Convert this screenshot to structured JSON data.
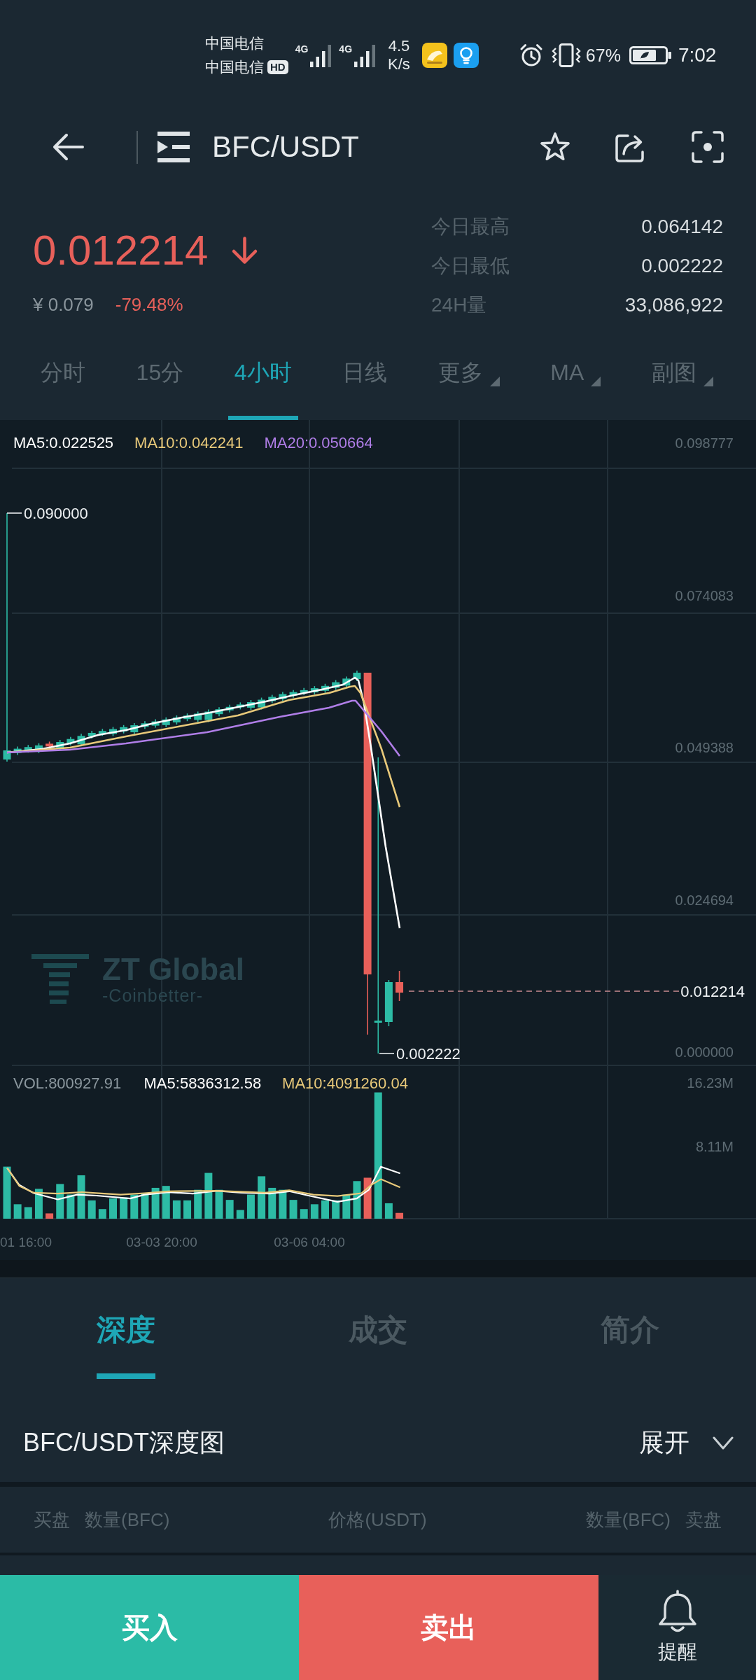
{
  "status_bar": {
    "carriers": [
      "中国电信",
      "中国电信"
    ],
    "hd_badge": "HD",
    "networks": [
      "4G",
      "4G"
    ],
    "speed": "4.5",
    "speed_unit": "K/s",
    "battery": "67%",
    "time": "7:02"
  },
  "header": {
    "title": "BFC/USDT"
  },
  "ticker": {
    "price": "0.012214",
    "falling": true,
    "cny_price": "¥ 0.079",
    "change": "-79.48%",
    "stats": [
      {
        "label": "今日最高",
        "value": "0.064142"
      },
      {
        "label": "今日最低",
        "value": "0.002222"
      },
      {
        "label": "24H量",
        "value": "33,086,922"
      }
    ]
  },
  "interval_tabs": [
    {
      "label": "分时",
      "selected": false,
      "dropdown": false
    },
    {
      "label": "15分",
      "selected": false,
      "dropdown": false
    },
    {
      "label": "4小时",
      "selected": true,
      "dropdown": false
    },
    {
      "label": "日线",
      "selected": false,
      "dropdown": false
    },
    {
      "label": "更多",
      "selected": false,
      "dropdown": true
    },
    {
      "label": "MA",
      "selected": false,
      "dropdown": true
    },
    {
      "label": "副图",
      "selected": false,
      "dropdown": true
    }
  ],
  "chart": {
    "legend": [
      {
        "text": "MA5:0.022525",
        "color": "#ffffff"
      },
      {
        "text": "MA10:0.042241",
        "color": "#e8c97a"
      },
      {
        "text": "MA20:0.050664",
        "color": "#b07ee8"
      }
    ],
    "price_axis": [
      "0.098777",
      "0.074083",
      "0.049388",
      "0.024694",
      "0.000000"
    ],
    "high_label": "0.090000",
    "low_label": "0.002222",
    "current_price": "0.012214",
    "logo": {
      "name": "ZT Global",
      "tagline": "-Coinbetter-"
    },
    "volume_legend": [
      {
        "text": "VOL:800927.91",
        "color": "#8b979e"
      },
      {
        "text": "MA5:5836312.58",
        "color": "#ffffff"
      },
      {
        "text": "MA10:4091260.04",
        "color": "#e8c97a"
      }
    ],
    "volume_axis": [
      "16.23M",
      "8.11M"
    ],
    "time_axis": [
      "01 16:00",
      "03-03 20:00",
      "03-06 04:00"
    ]
  },
  "detail_tabs": [
    {
      "label": "深度",
      "selected": true
    },
    {
      "label": "成交",
      "selected": false
    },
    {
      "label": "简介",
      "selected": false
    }
  ],
  "depth": {
    "title": "BFC/USDT深度图",
    "toggle": "展开",
    "columns": [
      "买盘",
      "数量(BFC)",
      "价格(USDT)",
      "数量(BFC)",
      "卖盘"
    ]
  },
  "actions": [
    {
      "label": "买入",
      "kind": "buy"
    },
    {
      "label": "卖出",
      "kind": "sell"
    },
    {
      "label": "提醒",
      "kind": "alert"
    }
  ]
}
